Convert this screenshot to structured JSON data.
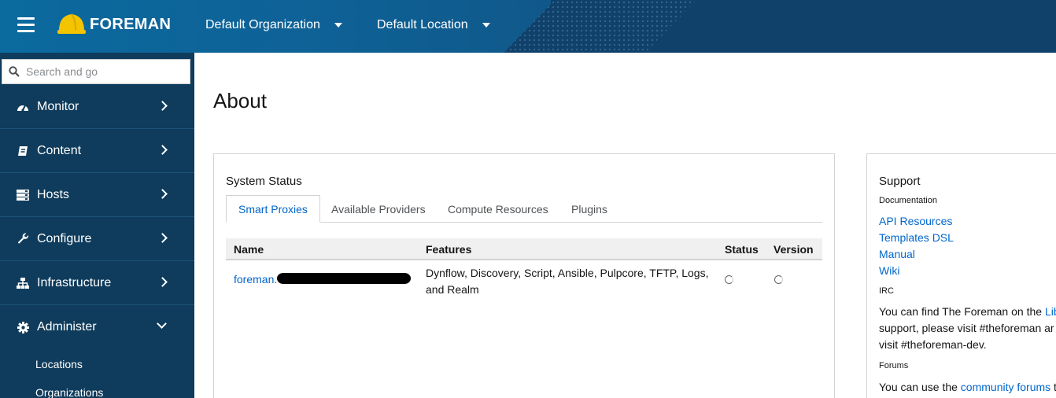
{
  "header": {
    "brand": "FOREMAN",
    "organization": "Default Organization",
    "location": "Default Location"
  },
  "sidebar": {
    "search_placeholder": "Search and go",
    "items": [
      {
        "label": "Monitor",
        "icon": "dashboard-icon"
      },
      {
        "label": "Content",
        "icon": "book-icon"
      },
      {
        "label": "Hosts",
        "icon": "server-icon"
      },
      {
        "label": "Configure",
        "icon": "wrench-icon"
      },
      {
        "label": "Infrastructure",
        "icon": "network-icon"
      },
      {
        "label": "Administer",
        "icon": "gear-icon",
        "expanded": true
      }
    ],
    "sub_items": [
      "Locations",
      "Organizations"
    ]
  },
  "main": {
    "title": "About",
    "system_status": {
      "title": "System Status",
      "tabs": [
        "Smart Proxies",
        "Available Providers",
        "Compute Resources",
        "Plugins"
      ],
      "active_tab": "Smart Proxies",
      "columns": [
        "Name",
        "Features",
        "Status",
        "Version"
      ],
      "rows": [
        {
          "name": "foreman.",
          "features_line1": "Dynflow, Discovery, Script, Ansible, Pulpcore, TFTP, Logs,",
          "features_line2": "and Realm"
        }
      ]
    },
    "support": {
      "title": "Support",
      "documentation_label": "Documentation",
      "doc_links": [
        "API Resources",
        "Templates DSL",
        "Manual",
        "Wiki"
      ],
      "irc_label": "IRC",
      "irc_line1_prefix": "You can find The Foreman on the ",
      "irc_line1_link": "Lib",
      "irc_line2": "support, please visit #theforeman ar",
      "irc_line3": "visit #theforeman-dev.",
      "forums_label": "Forums",
      "forums_prefix": "You can use the ",
      "forums_link": "community forums",
      "forums_suffix": " t"
    }
  },
  "colors": {
    "header_bg": "#10416a",
    "sidebar_bg": "#0f3c5c",
    "link": "#0066cc",
    "helmet": "#f5c400"
  }
}
